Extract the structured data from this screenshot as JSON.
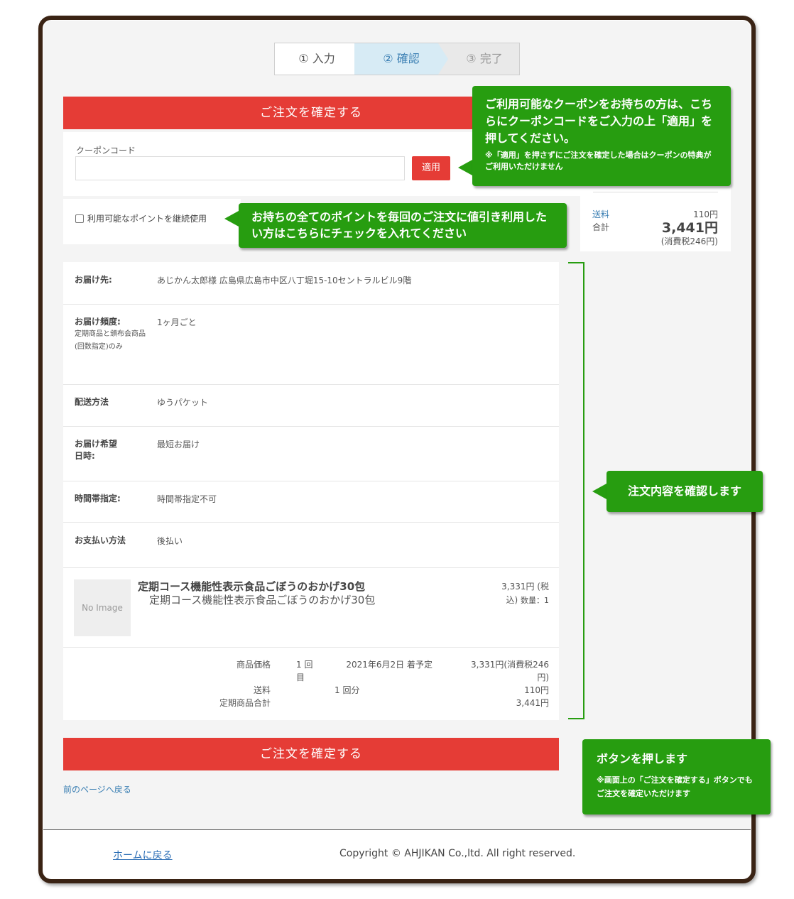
{
  "stepper": {
    "step1": "① 入力",
    "step2": "② 確認",
    "step3": "③ 完了"
  },
  "confirm_button_label": "ご注文を確定する",
  "coupon": {
    "label": "クーポンコード",
    "input_value": "",
    "apply_label": "適用"
  },
  "points": {
    "label": "利用可能なポイントを継続使用"
  },
  "summary": {
    "shipping_label": "送料",
    "shipping_value": "110円",
    "total_label": "合計",
    "total_value": "3,441円",
    "tax_note": "(消費税246円)"
  },
  "details": {
    "rows": [
      {
        "label": "お届け先:",
        "sub": "",
        "value": "あじかん太郎様 広島県広島市中区八丁堀15-10セントラルビル9階"
      },
      {
        "label": "お届け頻度:",
        "sub": "定期商品と頒布会商品(回数指定)のみ",
        "value": "1ヶ月ごと"
      },
      {
        "label": "配送方法",
        "sub": "",
        "value": "ゆうパケット"
      },
      {
        "label": "お届け希望日時:",
        "sub": "",
        "value": "最短お届け"
      },
      {
        "label": "時間帯指定:",
        "sub": "",
        "value": "時間帯指定不可"
      },
      {
        "label": "お支払い方法",
        "sub": "",
        "value": "後払い"
      }
    ]
  },
  "product": {
    "image_text": "No Image",
    "title": "定期コース機能性表示食品ごぼうのおかげ30包",
    "subtitle": "定期コース機能性表示食品ごぼうのおかげ30包",
    "price": "3,331円 (税込)",
    "qty": "数量：1"
  },
  "totals": {
    "price_label": "商品価格",
    "times": "1 回目",
    "date": "2021年6月2日 着予定",
    "price_value": "3,331円(消費税246円)",
    "shipping_label": "送料",
    "shipping_times": "1 回分",
    "shipping_value": "110円",
    "subtotal_label": "定期商品合計",
    "subtotal_value": "3,441円"
  },
  "back_link": "前のページへ戻る",
  "footer": {
    "home_link": "ホームに戻る",
    "copyright": "Copyright © AHJIKAN Co.,ltd. All right reserved."
  },
  "callouts": {
    "coupon": {
      "main": "ご利用可能なクーポンをお持ちの方は、こちらにクーポンコードをご入力の上「適用」を押してください。",
      "note": "※「適用」を押さずにご注文を確定した場合はクーポンの特典がご利用いただけません"
    },
    "points": "お持ちの全てのポイントを毎回のご注文に値引き利用したい方はこちらにチェックを入れてください",
    "confirm_contents": "注文内容を確認します",
    "button": {
      "main": "ボタンを押します",
      "note": "※画面上の「ご注文を確定する」ボタンでもご注文を確定いただけます"
    }
  },
  "colors": {
    "primary_red": "#e53c36",
    "callout_green": "#279d10",
    "frame_brown": "#3a2314",
    "link_blue": "#3b7fb3"
  }
}
